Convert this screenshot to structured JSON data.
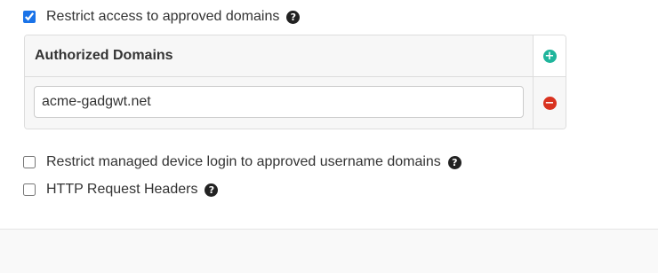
{
  "restrict_domains": {
    "label": "Restrict access to approved domains",
    "checked": true,
    "help_icon": "question-circle-icon"
  },
  "authorized_domains": {
    "header": "Authorized Domains",
    "add_icon": "plus-circle-icon",
    "remove_icon": "minus-circle-icon",
    "rows": [
      {
        "value": "acme-gadgwt.net"
      }
    ]
  },
  "restrict_managed_login": {
    "label": "Restrict managed device login to approved username domains",
    "checked": false,
    "help_icon": "question-circle-icon"
  },
  "http_headers": {
    "label": "HTTP Request Headers",
    "checked": false,
    "help_icon": "question-circle-icon"
  },
  "colors": {
    "add": "#1fb59c",
    "remove": "#d9321f",
    "checkbox_accent": "#1a73e8"
  }
}
